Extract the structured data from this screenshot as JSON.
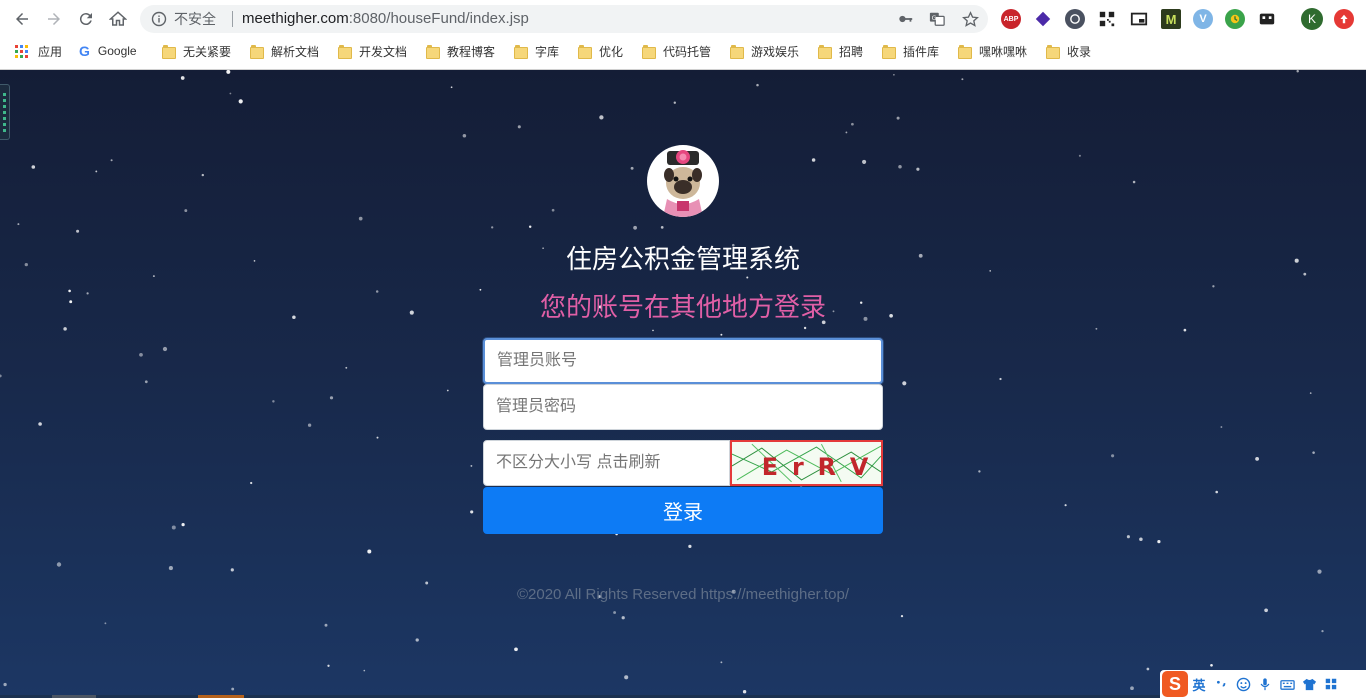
{
  "browser": {
    "security_label": "不安全",
    "url_host": "meethigher.com",
    "url_rest": ":8080/houseFund/index.jsp",
    "profile_initial": "K",
    "extensions": [
      "abp-icon",
      "gem-icon",
      "refresh-ext-icon",
      "qr-icon",
      "pip-icon",
      "m-icon",
      "v-icon",
      "clock-ext-icon",
      "film-icon"
    ],
    "bookmarks": [
      {
        "label": "应用",
        "kind": "apps"
      },
      {
        "label": "Google",
        "kind": "google"
      },
      {
        "label": "无关紧要",
        "kind": "folder"
      },
      {
        "label": "解析文档",
        "kind": "folder"
      },
      {
        "label": "开发文档",
        "kind": "folder"
      },
      {
        "label": "教程博客",
        "kind": "folder"
      },
      {
        "label": "字库",
        "kind": "folder"
      },
      {
        "label": "优化",
        "kind": "folder"
      },
      {
        "label": "代码托管",
        "kind": "folder"
      },
      {
        "label": "游戏娱乐",
        "kind": "folder"
      },
      {
        "label": "招聘",
        "kind": "folder"
      },
      {
        "label": "插件库",
        "kind": "folder"
      },
      {
        "label": "嘿咻嘿咻",
        "kind": "folder"
      },
      {
        "label": "收录",
        "kind": "folder"
      }
    ]
  },
  "login": {
    "system_title": "住房公积金管理系统",
    "notice": "您的账号在其他地方登录",
    "notice_color": "#e05fa6",
    "username_placeholder": "管理员账号",
    "password_placeholder": "管理员密码",
    "captcha_placeholder": "不区分大小写 点击刷新",
    "captcha_text": "ErRV",
    "submit_label": "登录",
    "accent_color": "#0d7bf5"
  },
  "footer": {
    "copyright": "©2020 All Rights Reserved https://meethigher.top/"
  },
  "ime": {
    "logo": "S",
    "mode": "英"
  }
}
